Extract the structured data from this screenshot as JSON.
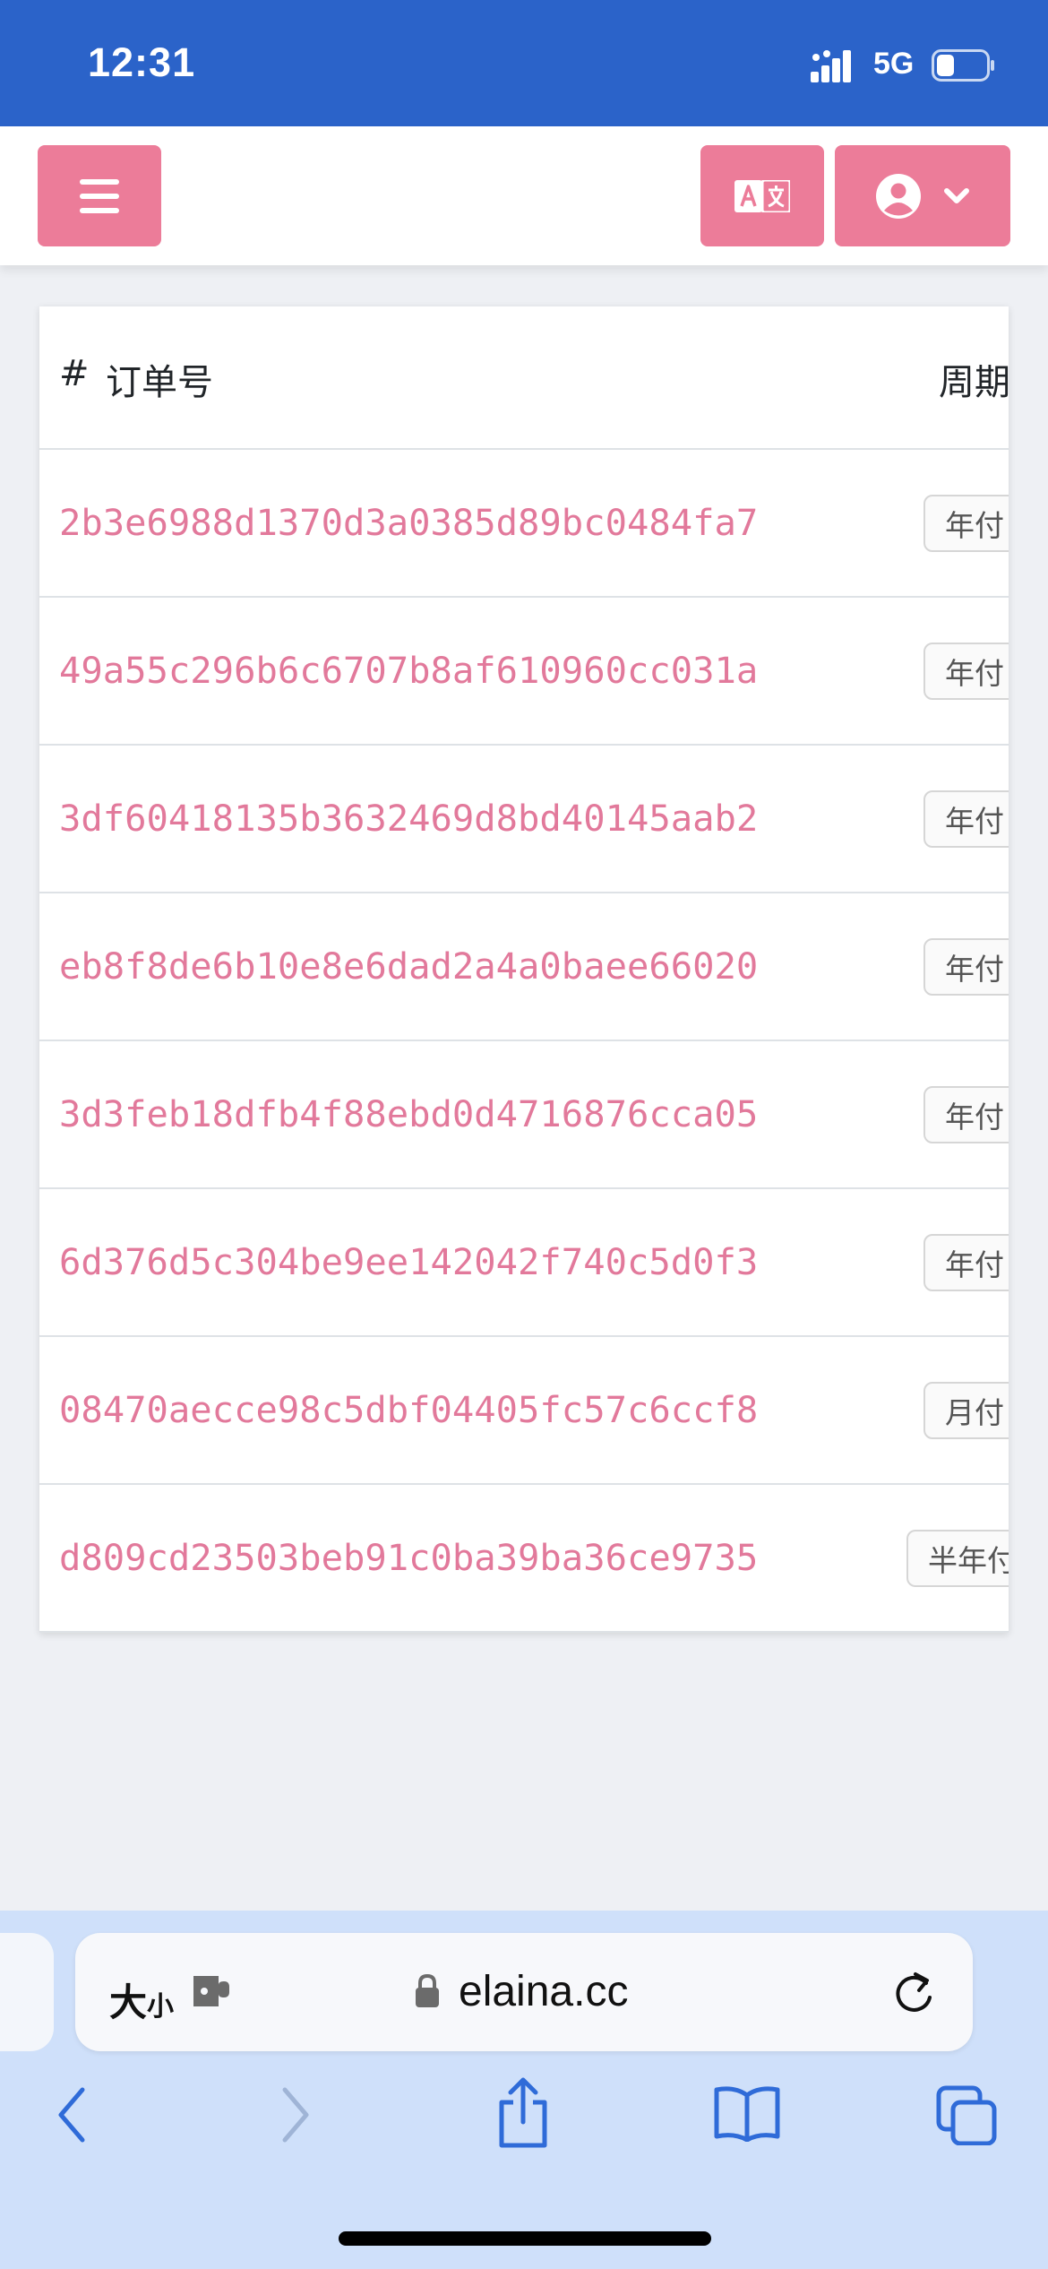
{
  "status_bar": {
    "time": "12:31",
    "network": "5G",
    "battery_level": 0.35,
    "icons": [
      "signal-icon",
      "battery-icon"
    ]
  },
  "navbar": {
    "accent_color": "#ec7c99",
    "icons": [
      "menu-icon",
      "translate-icon",
      "user-circle-icon",
      "chevron-down-icon"
    ]
  },
  "table": {
    "headers": {
      "hash": "#",
      "order_no": "订单号",
      "period": "周期"
    },
    "link_color": "#e2799b",
    "rows": [
      {
        "order_no": "2b3e6988d1370d3a0385d89bc0484fa7",
        "cycle": "年付"
      },
      {
        "order_no": "49a55c296b6c6707b8af610960cc031a",
        "cycle": "年付"
      },
      {
        "order_no": "3df60418135b3632469d8bd40145aab2",
        "cycle": "年付"
      },
      {
        "order_no": "eb8f8de6b10e8e6dad2a4a0baee66020",
        "cycle": "年付"
      },
      {
        "order_no": "3d3feb18dfb4f88ebd0d4716876cca05",
        "cycle": "年付"
      },
      {
        "order_no": "6d376d5c304be9ee142042f740c5d0f3",
        "cycle": "年付"
      },
      {
        "order_no": "08470aecce98c5dbf04405fc57c6ccf8",
        "cycle": "月付"
      },
      {
        "order_no": "d809cd23503beb91c0ba39ba36ce9735",
        "cycle": "半年付"
      }
    ]
  },
  "safari": {
    "size_label_big": "大",
    "size_label_small": "小",
    "url": "elaina.cc",
    "icons": [
      "extension-icon",
      "lock-icon",
      "reload-icon",
      "back-icon",
      "forward-icon",
      "share-icon",
      "bookmarks-icon",
      "tabs-icon"
    ]
  }
}
